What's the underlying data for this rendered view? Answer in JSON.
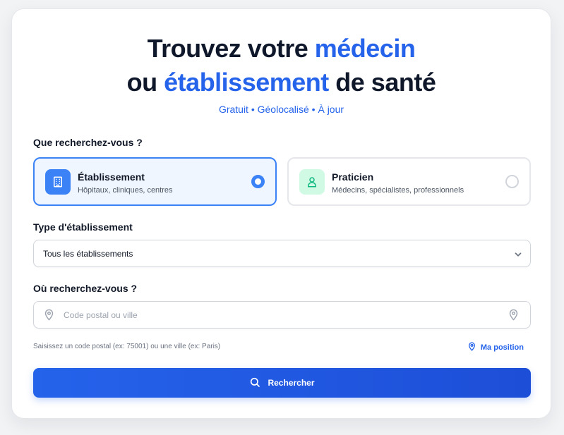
{
  "header": {
    "line1_prefix": "Trouvez votre",
    "line1_accent": "médecin",
    "line2_prefix": "ou",
    "line2_accent": "établissement",
    "line2_suffix": "de santé",
    "tagline": "Gratuit • Géolocalisé • À jour"
  },
  "search_type": {
    "label": "Que recherchez-vous ?",
    "options": [
      {
        "title": "Établissement",
        "subtitle": "Hôpitaux, cliniques, centres",
        "icon": "building-icon",
        "selected": true
      },
      {
        "title": "Praticien",
        "subtitle": "Médecins, spécialistes, professionnels",
        "icon": "user-icon",
        "selected": false
      }
    ]
  },
  "establishment_type": {
    "label": "Type d'établissement",
    "selected": "Tous les établissements"
  },
  "location": {
    "label": "Où recherchez-vous ?",
    "placeholder": "Code postal ou ville",
    "value": "",
    "help": "Saisissez un code postal (ex: 75001) ou une ville (ex: Paris)",
    "geo_label": "Ma position"
  },
  "search_button": {
    "label": "Rechercher",
    "icon": "search-icon"
  },
  "colors": {
    "accent": "#2563eb",
    "selected_border": "#3b82f6",
    "selected_bg": "#eff6ff",
    "praticien_badge": "#d1fae5"
  }
}
